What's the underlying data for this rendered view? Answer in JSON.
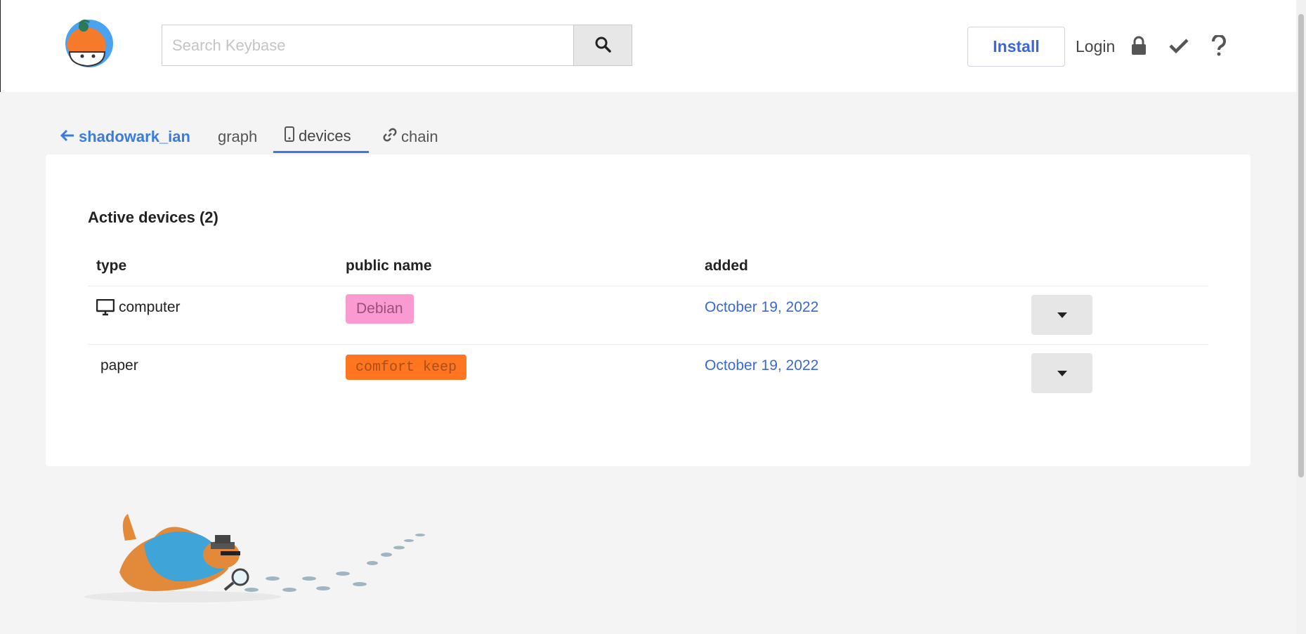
{
  "header": {
    "logo": "keybase-logo",
    "search": {
      "placeholder": "Search Keybase",
      "value": ""
    },
    "install_label": "Install",
    "login_label": "Login",
    "icons": [
      "lock-icon",
      "check-icon",
      "help-icon"
    ]
  },
  "tabs": {
    "back_label": "shadowark_ian",
    "items": [
      {
        "label": "graph",
        "icon": null
      },
      {
        "label": "devices",
        "icon": "phone-icon",
        "active": true
      },
      {
        "label": "chain",
        "icon": "link-icon"
      }
    ]
  },
  "devices": {
    "title": "Active devices (2)",
    "columns": [
      "type",
      "public name",
      "added"
    ],
    "rows": [
      {
        "type": "computer",
        "type_icon": "monitor-icon",
        "name": "Debian",
        "added": "October 19, 2022"
      },
      {
        "type": "paper",
        "type_icon": null,
        "name": "comfort keep",
        "added": "October 19, 2022"
      }
    ]
  },
  "colors": {
    "accent": "#3a7be0",
    "link": "#3a68d8",
    "badge_computer": "#f99ad0",
    "badge_paper": "#ff7520"
  }
}
